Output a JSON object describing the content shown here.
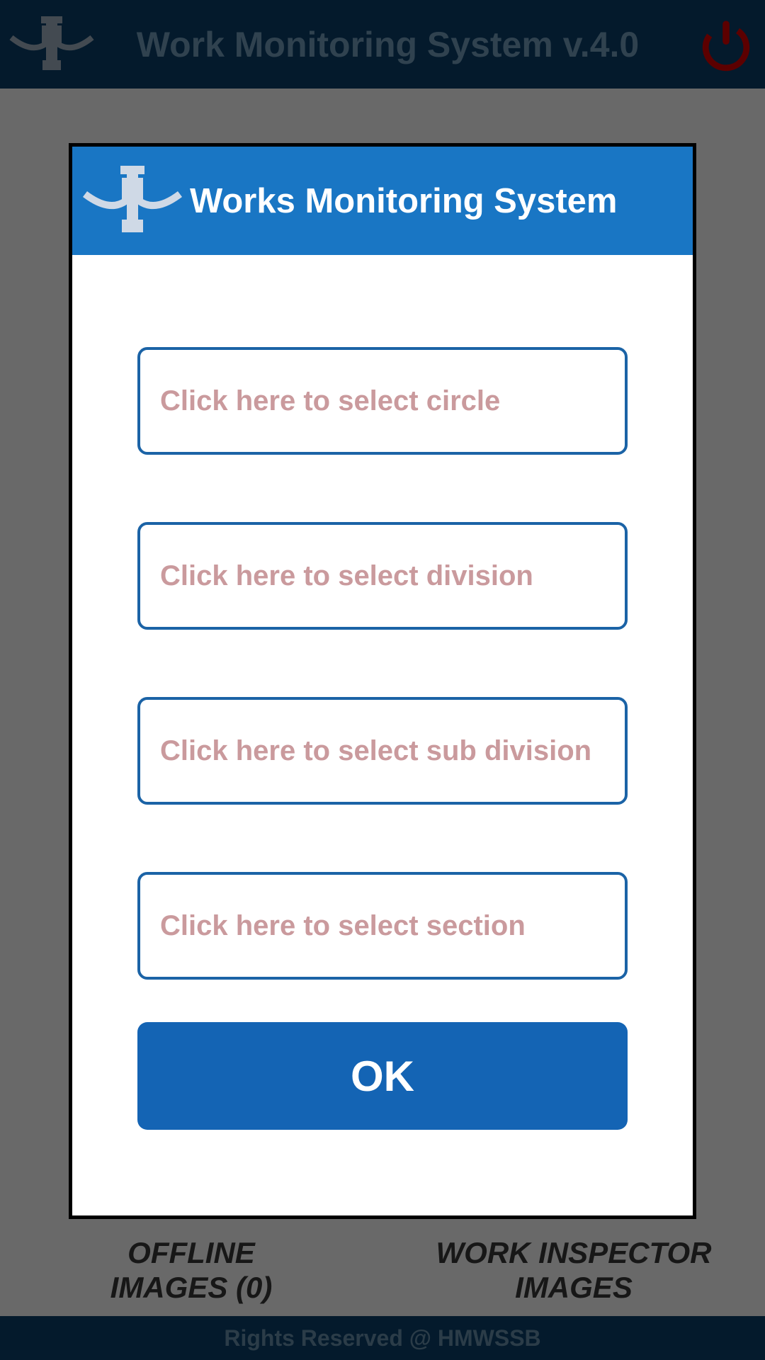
{
  "header": {
    "title": "Work Monitoring System v.4.0"
  },
  "tabs": {
    "offline_label_line1": "OFFLINE",
    "offline_label_line2": "IMAGES (0)",
    "inspector_label_line1": "WORK INSPECTOR",
    "inspector_label_line2": "IMAGES"
  },
  "footer": {
    "text": "Rights Reserved @ HMWSSB"
  },
  "modal": {
    "title": "Works Monitoring System",
    "fields": {
      "circle": "Click here to select circle",
      "division": "Click here to select division",
      "subdivision": "Click here to select sub division",
      "section": "Click here to select section"
    },
    "ok_label": "OK"
  }
}
